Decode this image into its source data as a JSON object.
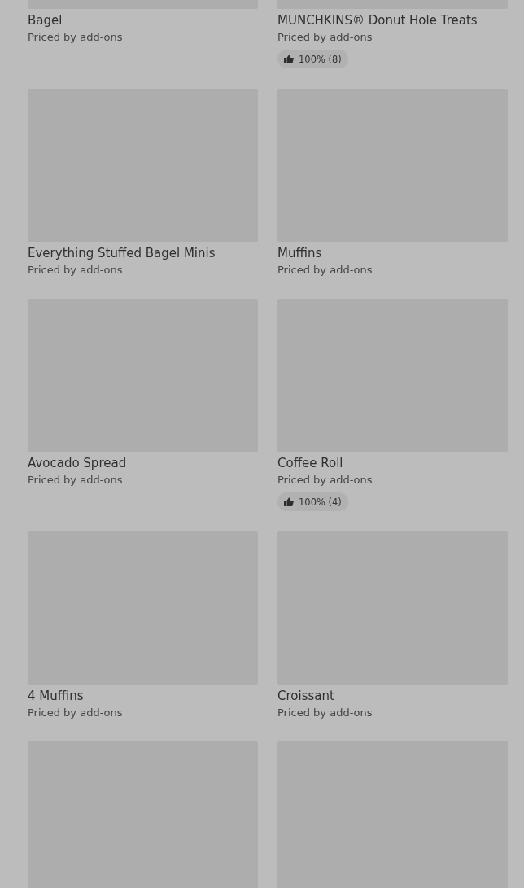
{
  "menu_items": [
    {
      "kind": "card",
      "name": "Bagel",
      "price_note": "Priced by add-ons"
    },
    {
      "kind": "card",
      "name": "MUNCHKINS® Donut Hole Treats",
      "price_note": "Priced by add-ons",
      "rating": "100% (8)"
    },
    {
      "kind": "card",
      "name": "Everything Stuffed Bagel Minis",
      "price_note": "Priced by add-ons"
    },
    {
      "kind": "card",
      "name": "Muffins",
      "price_note": "Priced by add-ons"
    },
    {
      "kind": "card",
      "name": "Avocado Spread",
      "price_note": "Priced by add-ons"
    },
    {
      "kind": "card",
      "name": "Coffee Roll",
      "price_note": "Priced by add-ons",
      "rating": "100% (4)"
    },
    {
      "kind": "card",
      "name": "4 Muffins",
      "price_note": "Priced by add-ons"
    },
    {
      "kind": "card",
      "name": "Croissant",
      "price_note": "Priced by add-ons"
    },
    {
      "kind": "image"
    },
    {
      "kind": "image"
    }
  ]
}
